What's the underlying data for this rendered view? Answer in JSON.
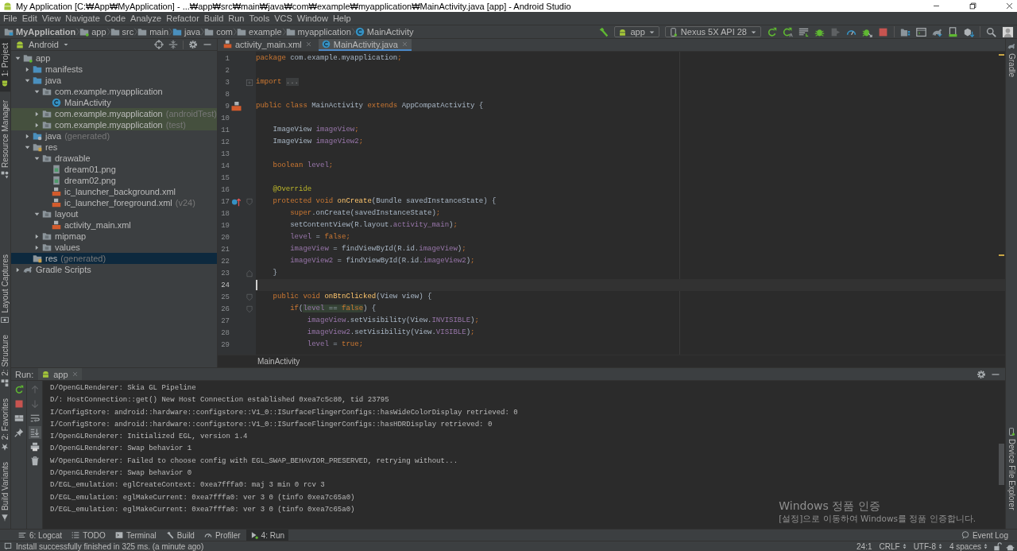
{
  "window": {
    "title": "My Application [C:₩App₩MyApplication] - ...₩app₩src₩main₩java₩com₩example₩myapplication₩MainActivity.java [app] - Android Studio"
  },
  "menu": [
    "File",
    "Edit",
    "View",
    "Navigate",
    "Code",
    "Analyze",
    "Refactor",
    "Build",
    "Run",
    "Tools",
    "VCS",
    "Window",
    "Help"
  ],
  "breadcrumb": [
    {
      "label": "MyApplication",
      "kind": "project"
    },
    {
      "label": "app",
      "kind": "module"
    },
    {
      "label": "src",
      "kind": "folder"
    },
    {
      "label": "main",
      "kind": "folder"
    },
    {
      "label": "java",
      "kind": "source-folder"
    },
    {
      "label": "com",
      "kind": "folder"
    },
    {
      "label": "example",
      "kind": "folder"
    },
    {
      "label": "myapplication",
      "kind": "folder"
    },
    {
      "label": "MainActivity",
      "kind": "class"
    }
  ],
  "run_config": {
    "module": "app",
    "device": "Nexus 5X API 28"
  },
  "left_tool_tabs": [
    {
      "label": "1: Project",
      "kind": "project",
      "selected": true
    },
    {
      "label": "Resource Manager",
      "kind": "resources",
      "selected": false
    },
    {
      "label": "Layout Captures",
      "kind": "captures",
      "selected": false
    },
    {
      "label": "2: Structure",
      "kind": "structure",
      "selected": false
    },
    {
      "label": "2: Favorites",
      "kind": "favorites",
      "selected": false
    },
    {
      "label": "Build Variants",
      "kind": "variants",
      "selected": false
    }
  ],
  "right_tool_tabs": [
    {
      "label": "Gradle",
      "kind": "gradle"
    },
    {
      "label": "Device File Explorer",
      "kind": "device"
    }
  ],
  "project": {
    "view": "Android",
    "tree": [
      {
        "label": "app",
        "kind": "module",
        "expanded": true,
        "selected": false,
        "test_scope": false,
        "children": [
          {
            "label": "manifests",
            "kind": "source-folder",
            "expanded": false,
            "selected": false,
            "test_scope": false
          },
          {
            "label": "java",
            "kind": "source-folder",
            "expanded": true,
            "selected": false,
            "test_scope": false,
            "children": [
              {
                "label": "com.example.myapplication",
                "kind": "package",
                "expanded": true,
                "selected": false,
                "test_scope": false,
                "children": [
                  {
                    "label": "MainActivity",
                    "kind": "class",
                    "selected": false,
                    "test_scope": false
                  }
                ]
              },
              {
                "label": "com.example.myapplication",
                "hint": "(androidTest)",
                "kind": "package",
                "expanded": false,
                "selected": false,
                "test_scope": true
              },
              {
                "label": "com.example.myapplication",
                "hint": "(test)",
                "kind": "package",
                "expanded": false,
                "selected": false,
                "test_scope": true
              }
            ]
          },
          {
            "label": "java",
            "hint": "(generated)",
            "kind": "generated",
            "expanded": false,
            "selected": false,
            "test_scope": false
          },
          {
            "label": "res",
            "kind": "res",
            "expanded": true,
            "selected": false,
            "test_scope": false,
            "children": [
              {
                "label": "drawable",
                "kind": "package",
                "expanded": true,
                "selected": false,
                "test_scope": false,
                "children": [
                  {
                    "label": "dream01.png",
                    "kind": "image",
                    "selected": false,
                    "test_scope": false
                  },
                  {
                    "label": "dream02.png",
                    "kind": "image",
                    "selected": false,
                    "test_scope": false
                  },
                  {
                    "label": "ic_launcher_background.xml",
                    "kind": "xml",
                    "selected": false,
                    "test_scope": false
                  },
                  {
                    "label": "ic_launcher_foreground.xml",
                    "hint": "(v24)",
                    "kind": "xml",
                    "selected": false,
                    "test_scope": false
                  }
                ]
              },
              {
                "label": "layout",
                "kind": "package",
                "expanded": true,
                "selected": false,
                "test_scope": false,
                "children": [
                  {
                    "label": "activity_main.xml",
                    "kind": "xml",
                    "selected": false,
                    "test_scope": false
                  }
                ]
              },
              {
                "label": "mipmap",
                "kind": "package",
                "expanded": false,
                "selected": false,
                "test_scope": false
              },
              {
                "label": "values",
                "kind": "package",
                "expanded": false,
                "selected": false,
                "test_scope": false
              }
            ]
          },
          {
            "label": "res",
            "hint": "(generated)",
            "kind": "res",
            "selected": true,
            "test_scope": false
          }
        ]
      },
      {
        "label": "Gradle Scripts",
        "kind": "gradle",
        "expanded": false,
        "selected": false,
        "test_scope": false
      }
    ]
  },
  "editor": {
    "tabs": [
      {
        "label": "activity_main.xml",
        "kind": "xml",
        "selected": false
      },
      {
        "label": "MainActivity.java",
        "kind": "class",
        "selected": true
      }
    ],
    "lines": [
      {
        "number": "1",
        "current": false,
        "tokens": [
          {
            "text": "package",
            "kind": "keyword"
          },
          {
            "text": " com.example.myapplication",
            "kind": "plain"
          },
          {
            "text": ";",
            "kind": "keyword"
          }
        ]
      },
      {
        "number": "2",
        "current": false
      },
      {
        "number": "3",
        "current": false,
        "fold_mark": {
          "kind": "expand"
        },
        "tokens": [
          {
            "text": "import ",
            "kind": "keyword"
          },
          {
            "text": "...",
            "kind": "folded"
          }
        ]
      },
      {
        "number": "8",
        "current": false
      },
      {
        "number": "9",
        "current": false,
        "gutter_mark": {
          "kind": "layout"
        },
        "tokens": [
          {
            "text": "public class",
            "kind": "keyword"
          },
          {
            "text": " MainActivity ",
            "kind": "plain"
          },
          {
            "text": "extends",
            "kind": "keyword"
          },
          {
            "text": " AppCompatActivity {",
            "kind": "plain"
          }
        ]
      },
      {
        "number": "10",
        "current": false
      },
      {
        "number": "11",
        "current": false,
        "tokens": [
          {
            "text": "    ImageView ",
            "kind": "plain"
          },
          {
            "text": "imageView",
            "kind": "field"
          },
          {
            "text": ";",
            "kind": "keyword"
          }
        ]
      },
      {
        "number": "12",
        "current": false,
        "tokens": [
          {
            "text": "    ImageView ",
            "kind": "plain"
          },
          {
            "text": "imageView2",
            "kind": "field"
          },
          {
            "text": ";",
            "kind": "keyword"
          }
        ]
      },
      {
        "number": "13",
        "current": false
      },
      {
        "number": "14",
        "current": false,
        "tokens": [
          {
            "text": "    boolean",
            "kind": "keyword"
          },
          {
            "text": " level",
            "kind": "field"
          },
          {
            "text": ";",
            "kind": "keyword"
          }
        ]
      },
      {
        "number": "15",
        "current": false
      },
      {
        "number": "16",
        "current": false,
        "tokens": [
          {
            "text": "    @Override",
            "kind": "annotation"
          }
        ]
      },
      {
        "number": "17",
        "current": false,
        "gutter_mark": {
          "kind": "override"
        },
        "fold_mark": {
          "kind": "start"
        },
        "tokens": [
          {
            "text": "    protected void",
            "kind": "keyword"
          },
          {
            "text": " onCreate",
            "kind": "method"
          },
          {
            "text": "(Bundle savedInstanceState) {",
            "kind": "plain"
          }
        ]
      },
      {
        "number": "18",
        "current": false,
        "tokens": [
          {
            "text": "        super",
            "kind": "keyword"
          },
          {
            "text": ".onCreate(savedInstanceState)",
            "kind": "plain"
          },
          {
            "text": ";",
            "kind": "keyword"
          }
        ]
      },
      {
        "number": "19",
        "current": false,
        "tokens": [
          {
            "text": "        setContentView(R.layout.",
            "kind": "plain"
          },
          {
            "text": "activity_main",
            "kind": "field"
          },
          {
            "text": ")",
            "kind": "plain"
          },
          {
            "text": ";",
            "kind": "keyword"
          }
        ]
      },
      {
        "number": "20",
        "current": false,
        "tokens": [
          {
            "text": "        level",
            "kind": "field"
          },
          {
            "text": " = ",
            "kind": "plain"
          },
          {
            "text": "false;",
            "kind": "keyword"
          }
        ]
      },
      {
        "number": "21",
        "current": false,
        "tokens": [
          {
            "text": "        imageView",
            "kind": "field"
          },
          {
            "text": " = findViewById(R.id.",
            "kind": "plain"
          },
          {
            "text": "imageView",
            "kind": "field"
          },
          {
            "text": ")",
            "kind": "plain"
          },
          {
            "text": ";",
            "kind": "keyword"
          }
        ]
      },
      {
        "number": "22",
        "current": false,
        "tokens": [
          {
            "text": "        imageView2",
            "kind": "field"
          },
          {
            "text": " = findViewById(R.id.",
            "kind": "plain"
          },
          {
            "text": "imageView2",
            "kind": "field"
          },
          {
            "text": ")",
            "kind": "plain"
          },
          {
            "text": ";",
            "kind": "keyword"
          }
        ]
      },
      {
        "number": "23",
        "current": false,
        "fold_mark": {
          "kind": "end"
        },
        "tokens": [
          {
            "text": "    }",
            "kind": "plain"
          }
        ]
      },
      {
        "number": "24",
        "current": true
      },
      {
        "number": "25",
        "current": false,
        "fold_mark": {
          "kind": "start"
        },
        "tokens": [
          {
            "text": "    public void",
            "kind": "keyword"
          },
          {
            "text": " onBtnClicked",
            "kind": "method"
          },
          {
            "text": "(View view) {",
            "kind": "plain"
          }
        ]
      },
      {
        "number": "26",
        "current": false,
        "fold_mark": {
          "kind": "start"
        },
        "tokens": [
          {
            "text": "        if",
            "kind": "keyword"
          },
          {
            "text": "(",
            "kind": "plain"
          },
          {
            "text": "level",
            "kind": "field-match"
          },
          {
            "text": " == ",
            "kind": "plain-match"
          },
          {
            "text": "false",
            "kind": "keyword-match"
          },
          {
            "text": ") {",
            "kind": "plain"
          }
        ]
      },
      {
        "number": "27",
        "current": false,
        "tokens": [
          {
            "text": "            imageView",
            "kind": "field"
          },
          {
            "text": ".setVisibility(View.",
            "kind": "plain"
          },
          {
            "text": "INVISIBLE",
            "kind": "field"
          },
          {
            "text": ")",
            "kind": "plain"
          },
          {
            "text": ";",
            "kind": "keyword"
          }
        ]
      },
      {
        "number": "28",
        "current": false,
        "tokens": [
          {
            "text": "            imageView2",
            "kind": "field"
          },
          {
            "text": ".setVisibility(View.",
            "kind": "plain"
          },
          {
            "text": "VISIBLE",
            "kind": "field"
          },
          {
            "text": ")",
            "kind": "plain"
          },
          {
            "text": ";",
            "kind": "keyword"
          }
        ]
      },
      {
        "number": "29",
        "current": false,
        "tokens": [
          {
            "text": "            level",
            "kind": "field"
          },
          {
            "text": " = ",
            "kind": "plain"
          },
          {
            "text": "true;",
            "kind": "keyword"
          }
        ]
      }
    ],
    "breadcrumb": "MainActivity"
  },
  "run": {
    "title": "Run:",
    "tab": "app",
    "console": [
      "D/OpenGLRenderer: Skia GL Pipeline",
      "D/: HostConnection::get() New Host Connection established 0xea7c5c80, tid 23795",
      "I/ConfigStore: android::hardware::configstore::V1_0::ISurfaceFlingerConfigs::hasWideColorDisplay retrieved: 0",
      "I/ConfigStore: android::hardware::configstore::V1_0::ISurfaceFlingerConfigs::hasHDRDisplay retrieved: 0",
      "I/OpenGLRenderer: Initialized EGL, version 1.4",
      "D/OpenGLRenderer: Swap behavior 1",
      "W/OpenGLRenderer: Failed to choose config with EGL_SWAP_BEHAVIOR_PRESERVED, retrying without...",
      "D/OpenGLRenderer: Swap behavior 0",
      "D/EGL_emulation: eglCreateContext: 0xea7fffa0: maj 3 min 0 rcv 3",
      "D/EGL_emulation: eglMakeCurrent: 0xea7fffa0: ver 3 0 (tinfo 0xea7c65a0)",
      "D/EGL_emulation: eglMakeCurrent: 0xea7fffa0: ver 3 0 (tinfo 0xea7c65a0)"
    ]
  },
  "activation_notice": {
    "title": "Windows 정품 인증",
    "body": "[설정]으로 이동하여 Windows를 정품 인증합니다."
  },
  "tool_windows": [
    {
      "label": "6: Logcat",
      "kind": "logcat",
      "selected": false
    },
    {
      "label": "TODO",
      "kind": "todo",
      "selected": false
    },
    {
      "label": "Terminal",
      "kind": "terminal",
      "selected": false
    },
    {
      "label": "Build",
      "kind": "build",
      "selected": false
    },
    {
      "label": "Profiler",
      "kind": "profiler",
      "selected": false
    },
    {
      "label": "4: Run",
      "kind": "run",
      "selected": true
    }
  ],
  "event_log": "Event Log",
  "status_bar": {
    "message": "Install successfully finished in 325 ms. (a minute ago)",
    "position": "24:1",
    "settings": [
      "CRLF",
      "UTF-8",
      "4 spaces"
    ]
  }
}
